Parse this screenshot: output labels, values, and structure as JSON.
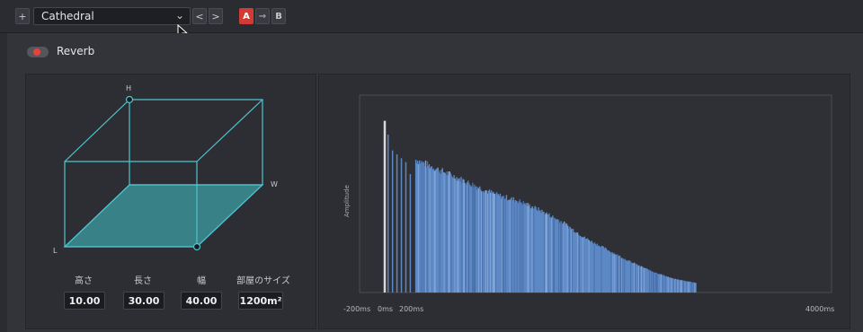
{
  "toolbar": {
    "add_label": "+",
    "preset_value": "Cathedral",
    "prev_label": "<",
    "next_label": ">",
    "a_label": "A",
    "copy_label": "→",
    "b_label": "B"
  },
  "plugin": {
    "title": "Reverb",
    "enabled": true,
    "accent": "#e8413a"
  },
  "room": {
    "corner_h": "H",
    "corner_w": "W",
    "corner_l": "L",
    "wire_color": "#4fc4d0",
    "fields": [
      {
        "label": "高さ",
        "value": "10.00"
      },
      {
        "label": "長さ",
        "value": "30.00"
      },
      {
        "label": "幅",
        "value": "40.00"
      },
      {
        "label": "部屋のサイズ",
        "value": "1200m²"
      }
    ]
  },
  "chart_data": {
    "type": "bar",
    "ylabel": "Amplitude",
    "x_ticks": [
      "-200ms",
      "0ms",
      "200ms",
      "4000ms"
    ],
    "bar_color": "#5d88c4",
    "early_reflections": [
      {
        "t": 0,
        "a": 0.87,
        "color": "#d8d8dc"
      },
      {
        "t": 30,
        "a": 0.8
      },
      {
        "t": 70,
        "a": 0.72
      },
      {
        "t": 110,
        "a": 0.7
      },
      {
        "t": 150,
        "a": 0.68
      },
      {
        "t": 190,
        "a": 0.66
      },
      {
        "t": 230,
        "a": 0.6
      }
    ],
    "decay": [
      [
        280,
        0.68
      ],
      [
        400,
        0.65
      ],
      [
        600,
        0.6
      ],
      [
        800,
        0.55
      ],
      [
        1000,
        0.5
      ],
      [
        1200,
        0.47
      ],
      [
        1400,
        0.42
      ],
      [
        1600,
        0.36
      ],
      [
        1800,
        0.28
      ],
      [
        2000,
        0.22
      ],
      [
        2200,
        0.16
      ],
      [
        2400,
        0.11
      ],
      [
        2600,
        0.07
      ],
      [
        2800,
        0.05
      ]
    ],
    "xlim": [
      -200,
      4000
    ],
    "ylim": [
      0,
      1
    ]
  }
}
